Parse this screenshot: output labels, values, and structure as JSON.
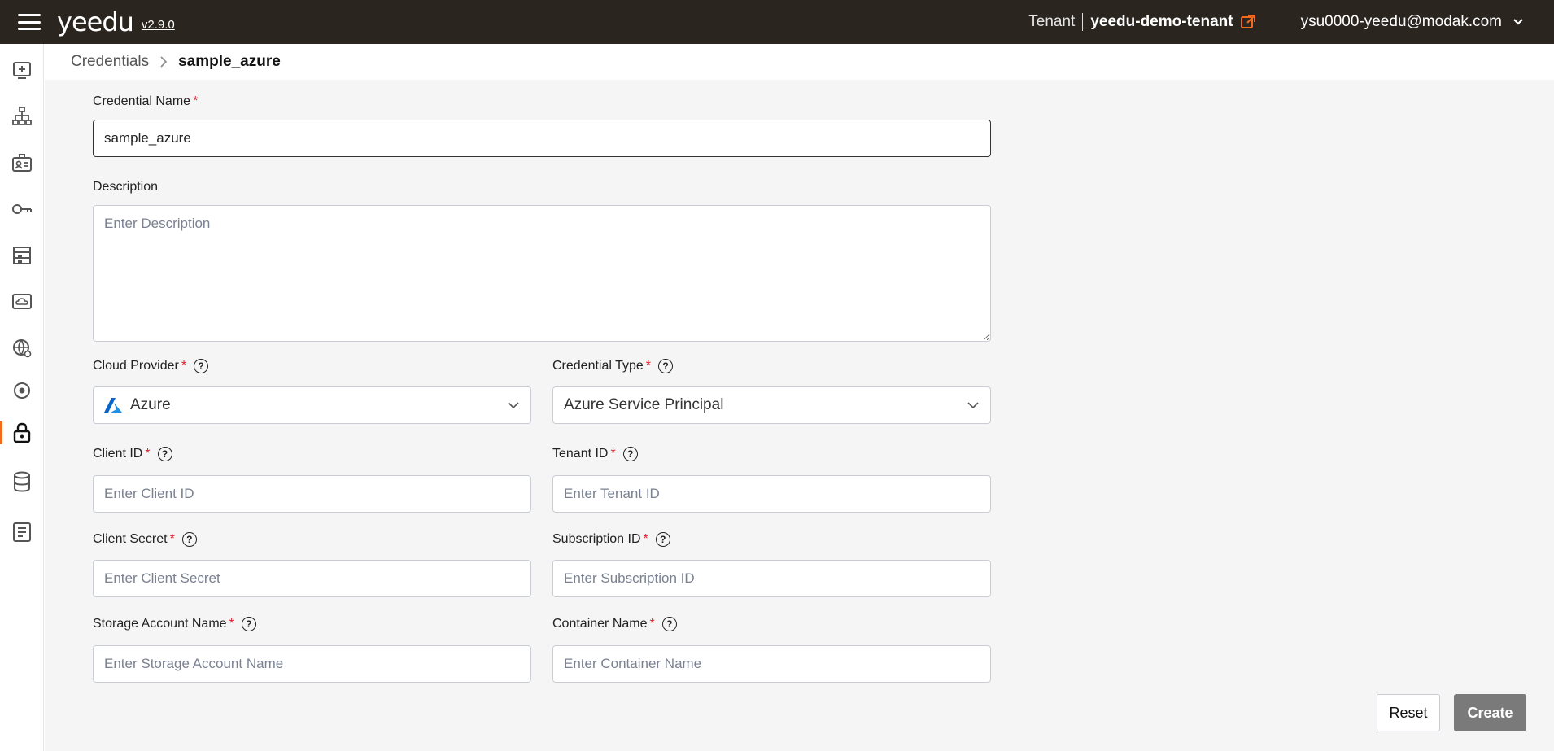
{
  "app": {
    "logo_text": "yeedu",
    "version": "v2.9.0",
    "tenant_label": "Tenant",
    "tenant_name": "yeedu-demo-tenant",
    "user_email": "ysu0000-yeedu@modak.com",
    "accent_color": "#f26a1b",
    "topbar_color": "#2b2520"
  },
  "sidebar": {
    "items": [
      {
        "icon": "add-workspace-icon"
      },
      {
        "icon": "hierarchy-icon"
      },
      {
        "icon": "id-card-icon"
      },
      {
        "icon": "key-icon"
      },
      {
        "icon": "building-icon"
      },
      {
        "icon": "cloud-monitor-icon"
      },
      {
        "icon": "globe-network-icon"
      },
      {
        "icon": "target-icon"
      },
      {
        "icon": "lock-icon",
        "active": true
      },
      {
        "icon": "database-icon"
      },
      {
        "icon": "notebook-icon"
      }
    ]
  },
  "breadcrumb": {
    "parent": "Credentials",
    "current": "sample_azure"
  },
  "form": {
    "credential_name": {
      "label": "Credential Name",
      "value": "sample_azure"
    },
    "description": {
      "label": "Description",
      "placeholder": "Enter Description"
    },
    "cloud_provider": {
      "label": "Cloud Provider",
      "value": "Azure"
    },
    "credential_type": {
      "label": "Credential Type",
      "value": "Azure Service Principal"
    },
    "client_id": {
      "label": "Client ID",
      "placeholder": "Enter Client ID"
    },
    "tenant_id": {
      "label": "Tenant ID",
      "placeholder": "Enter Tenant ID"
    },
    "client_secret": {
      "label": "Client Secret",
      "placeholder": "Enter Client Secret"
    },
    "subscription_id": {
      "label": "Subscription ID",
      "placeholder": "Enter Subscription ID"
    },
    "storage_account_name": {
      "label": "Storage Account Name",
      "placeholder": "Enter Storage Account Name"
    },
    "container_name": {
      "label": "Container Name",
      "placeholder": "Enter Container Name"
    },
    "required_mark": "*",
    "help_glyph": "?"
  },
  "actions": {
    "reset_label": "Reset",
    "create_label": "Create"
  }
}
